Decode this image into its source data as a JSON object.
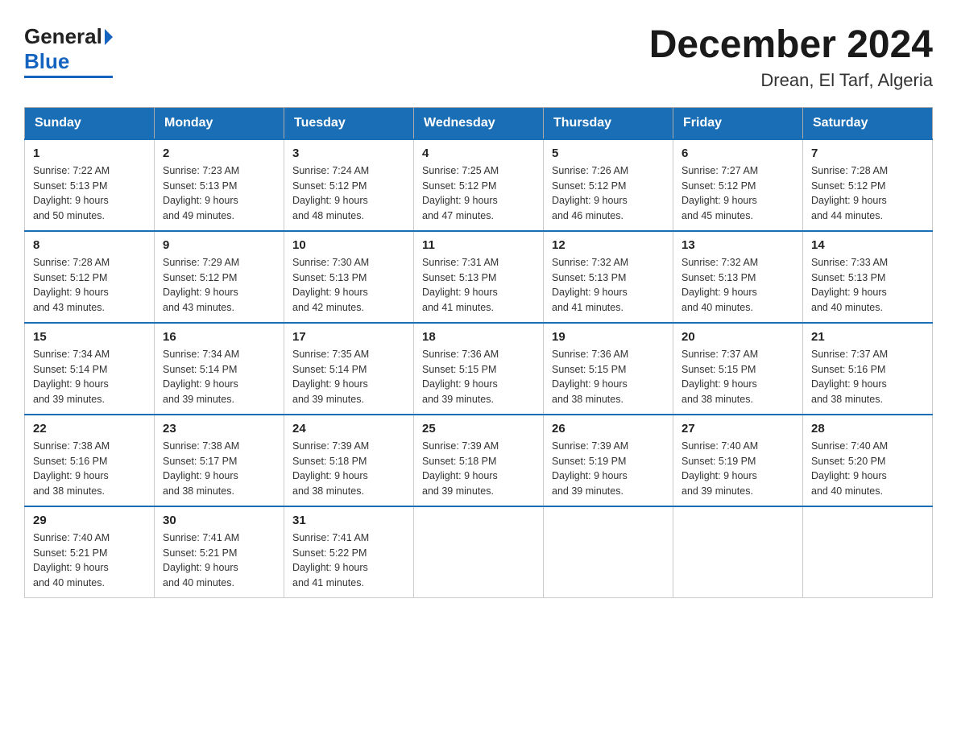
{
  "header": {
    "title": "December 2024",
    "subtitle": "Drean, El Tarf, Algeria"
  },
  "days_of_week": [
    "Sunday",
    "Monday",
    "Tuesday",
    "Wednesday",
    "Thursday",
    "Friday",
    "Saturday"
  ],
  "weeks": [
    [
      {
        "day": "1",
        "sunrise": "7:22 AM",
        "sunset": "5:13 PM",
        "daylight": "9 hours and 50 minutes."
      },
      {
        "day": "2",
        "sunrise": "7:23 AM",
        "sunset": "5:13 PM",
        "daylight": "9 hours and 49 minutes."
      },
      {
        "day": "3",
        "sunrise": "7:24 AM",
        "sunset": "5:12 PM",
        "daylight": "9 hours and 48 minutes."
      },
      {
        "day": "4",
        "sunrise": "7:25 AM",
        "sunset": "5:12 PM",
        "daylight": "9 hours and 47 minutes."
      },
      {
        "day": "5",
        "sunrise": "7:26 AM",
        "sunset": "5:12 PM",
        "daylight": "9 hours and 46 minutes."
      },
      {
        "day": "6",
        "sunrise": "7:27 AM",
        "sunset": "5:12 PM",
        "daylight": "9 hours and 45 minutes."
      },
      {
        "day": "7",
        "sunrise": "7:28 AM",
        "sunset": "5:12 PM",
        "daylight": "9 hours and 44 minutes."
      }
    ],
    [
      {
        "day": "8",
        "sunrise": "7:28 AM",
        "sunset": "5:12 PM",
        "daylight": "9 hours and 43 minutes."
      },
      {
        "day": "9",
        "sunrise": "7:29 AM",
        "sunset": "5:12 PM",
        "daylight": "9 hours and 43 minutes."
      },
      {
        "day": "10",
        "sunrise": "7:30 AM",
        "sunset": "5:13 PM",
        "daylight": "9 hours and 42 minutes."
      },
      {
        "day": "11",
        "sunrise": "7:31 AM",
        "sunset": "5:13 PM",
        "daylight": "9 hours and 41 minutes."
      },
      {
        "day": "12",
        "sunrise": "7:32 AM",
        "sunset": "5:13 PM",
        "daylight": "9 hours and 41 minutes."
      },
      {
        "day": "13",
        "sunrise": "7:32 AM",
        "sunset": "5:13 PM",
        "daylight": "9 hours and 40 minutes."
      },
      {
        "day": "14",
        "sunrise": "7:33 AM",
        "sunset": "5:13 PM",
        "daylight": "9 hours and 40 minutes."
      }
    ],
    [
      {
        "day": "15",
        "sunrise": "7:34 AM",
        "sunset": "5:14 PM",
        "daylight": "9 hours and 39 minutes."
      },
      {
        "day": "16",
        "sunrise": "7:34 AM",
        "sunset": "5:14 PM",
        "daylight": "9 hours and 39 minutes."
      },
      {
        "day": "17",
        "sunrise": "7:35 AM",
        "sunset": "5:14 PM",
        "daylight": "9 hours and 39 minutes."
      },
      {
        "day": "18",
        "sunrise": "7:36 AM",
        "sunset": "5:15 PM",
        "daylight": "9 hours and 39 minutes."
      },
      {
        "day": "19",
        "sunrise": "7:36 AM",
        "sunset": "5:15 PM",
        "daylight": "9 hours and 38 minutes."
      },
      {
        "day": "20",
        "sunrise": "7:37 AM",
        "sunset": "5:15 PM",
        "daylight": "9 hours and 38 minutes."
      },
      {
        "day": "21",
        "sunrise": "7:37 AM",
        "sunset": "5:16 PM",
        "daylight": "9 hours and 38 minutes."
      }
    ],
    [
      {
        "day": "22",
        "sunrise": "7:38 AM",
        "sunset": "5:16 PM",
        "daylight": "9 hours and 38 minutes."
      },
      {
        "day": "23",
        "sunrise": "7:38 AM",
        "sunset": "5:17 PM",
        "daylight": "9 hours and 38 minutes."
      },
      {
        "day": "24",
        "sunrise": "7:39 AM",
        "sunset": "5:18 PM",
        "daylight": "9 hours and 38 minutes."
      },
      {
        "day": "25",
        "sunrise": "7:39 AM",
        "sunset": "5:18 PM",
        "daylight": "9 hours and 39 minutes."
      },
      {
        "day": "26",
        "sunrise": "7:39 AM",
        "sunset": "5:19 PM",
        "daylight": "9 hours and 39 minutes."
      },
      {
        "day": "27",
        "sunrise": "7:40 AM",
        "sunset": "5:19 PM",
        "daylight": "9 hours and 39 minutes."
      },
      {
        "day": "28",
        "sunrise": "7:40 AM",
        "sunset": "5:20 PM",
        "daylight": "9 hours and 40 minutes."
      }
    ],
    [
      {
        "day": "29",
        "sunrise": "7:40 AM",
        "sunset": "5:21 PM",
        "daylight": "9 hours and 40 minutes."
      },
      {
        "day": "30",
        "sunrise": "7:41 AM",
        "sunset": "5:21 PM",
        "daylight": "9 hours and 40 minutes."
      },
      {
        "day": "31",
        "sunrise": "7:41 AM",
        "sunset": "5:22 PM",
        "daylight": "9 hours and 41 minutes."
      },
      null,
      null,
      null,
      null
    ]
  ],
  "labels": {
    "sunrise": "Sunrise:",
    "sunset": "Sunset:",
    "daylight": "Daylight:"
  }
}
